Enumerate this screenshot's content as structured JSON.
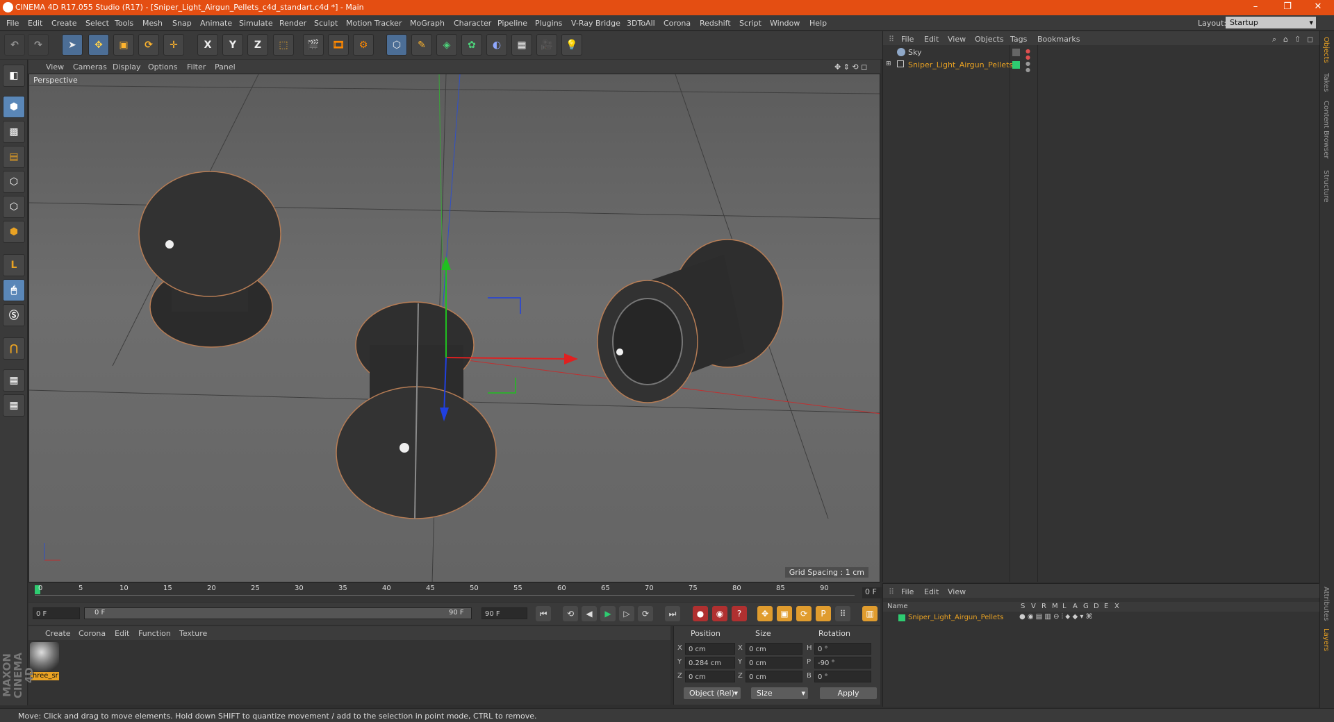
{
  "window": {
    "title": "CINEMA 4D R17.055 Studio (R17) - [Sniper_Light_Airgun_Pellets_c4d_standart.c4d *] - Main",
    "controls": [
      "–",
      "❐",
      "✕"
    ]
  },
  "menubar": {
    "items": [
      "File",
      "Edit",
      "Create",
      "Select",
      "Tools",
      "Mesh",
      "Snap",
      "Animate",
      "Simulate",
      "Render",
      "Sculpt",
      "Motion Tracker",
      "MoGraph",
      "Character",
      "Pipeline",
      "Plugins",
      "V-Ray Bridge",
      "3DToAll",
      "Corona",
      "Redshift",
      "Script",
      "Window",
      "Help"
    ],
    "layout_label": "Layout:",
    "layout_value": "Startup"
  },
  "toolbar": {
    "axis_x": "X",
    "axis_y": "Y",
    "axis_z": "Z"
  },
  "viewport": {
    "menu": [
      "View",
      "Cameras",
      "Display",
      "Options",
      "Filter",
      "Panel"
    ],
    "label": "Perspective",
    "grid_spacing": "Grid Spacing : 1 cm"
  },
  "timeline": {
    "ticks": [
      "0",
      "5",
      "10",
      "15",
      "20",
      "25",
      "30",
      "35",
      "40",
      "45",
      "50",
      "55",
      "60",
      "65",
      "70",
      "75",
      "80",
      "85",
      "90"
    ],
    "current_frame": "0 F"
  },
  "playback": {
    "start": "0 F",
    "range_start": "0 F",
    "range_end": "90 F",
    "end": "90 F"
  },
  "material_manager": {
    "menu": [
      "Create",
      "Corona",
      "Edit",
      "Function",
      "Texture"
    ],
    "materials": [
      {
        "name": "three_sr"
      }
    ]
  },
  "coordinates": {
    "headers": {
      "position": "Position",
      "size": "Size",
      "rotation": "Rotation"
    },
    "rows": [
      {
        "axis": "X",
        "pos": "0 cm",
        "size_axis": "X",
        "size": "0 cm",
        "rot_axis": "H",
        "rot": "0 °"
      },
      {
        "axis": "Y",
        "pos": "0.284 cm",
        "size_axis": "Y",
        "size": "0 cm",
        "rot_axis": "P",
        "rot": "-90 °"
      },
      {
        "axis": "Z",
        "pos": "0 cm",
        "size_axis": "Z",
        "size": "0 cm",
        "rot_axis": "B",
        "rot": "0 °"
      }
    ],
    "mode": "Object (Rel)",
    "size_mode": "Size",
    "apply": "Apply"
  },
  "object_manager": {
    "menu": [
      "File",
      "Edit",
      "View",
      "Objects",
      "Tags",
      "Bookmarks"
    ],
    "objects": [
      {
        "name": "Sky",
        "color": "#c8c8c8"
      },
      {
        "name": "Sniper_Light_Airgun_Pellets",
        "color": "#e9a223"
      }
    ]
  },
  "layer_manager": {
    "menu": [
      "File",
      "Edit",
      "View"
    ],
    "header_name": "Name",
    "columns": [
      "S",
      "V",
      "R",
      "M",
      "L",
      "A",
      "G",
      "D",
      "E",
      "X"
    ],
    "layers": [
      {
        "name": "Sniper_Light_Airgun_Pellets",
        "color": "#2ecc71"
      }
    ]
  },
  "side_tabs": [
    "Objects",
    "Takes",
    "Content Browser",
    "Structure"
  ],
  "side_tabs_bottom": [
    "Attributes",
    "Layers"
  ],
  "brand": {
    "logo": "MAXON CINEMA 4D"
  },
  "statusbar": {
    "text": "Move: Click and drag to move elements. Hold down SHIFT to quantize movement / add to the selection in point mode, CTRL to remove."
  }
}
